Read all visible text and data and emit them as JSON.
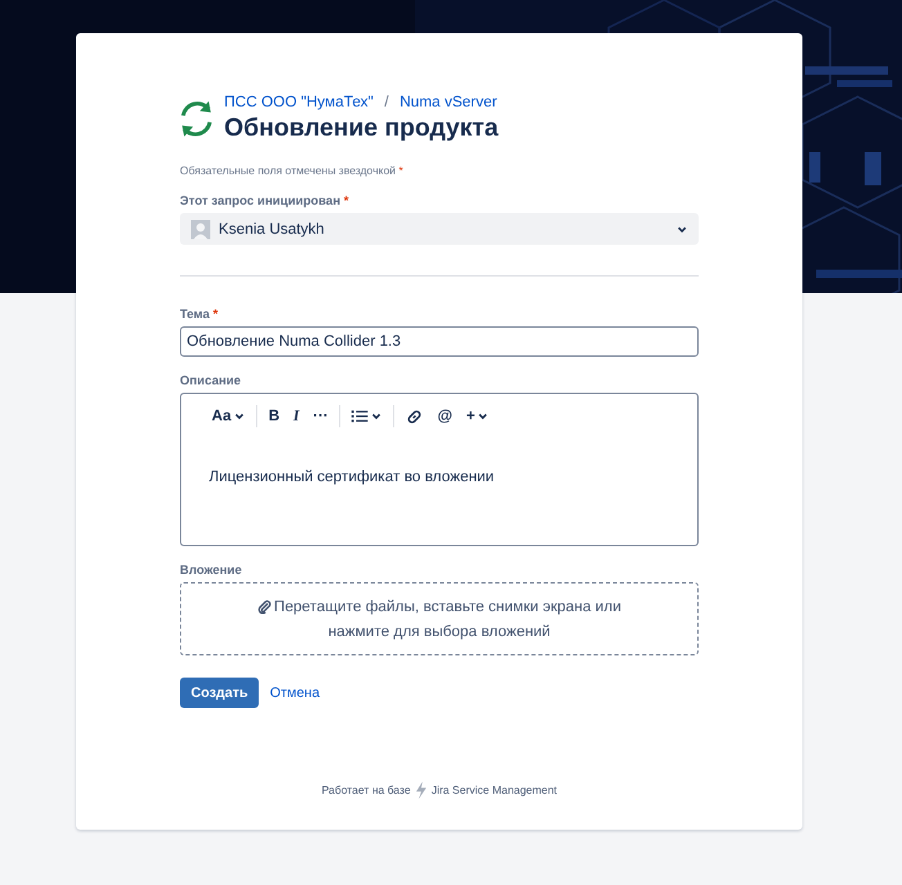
{
  "breadcrumbs": [
    {
      "label": "ПСС ООО \"НумаТех\""
    },
    {
      "label": "Numa vServer"
    }
  ],
  "breadcrumb_separator": "/",
  "title": "Обновление продукта",
  "required_note": "Обязательные поля отмечены звездочкой",
  "required_mark": "*",
  "fields": [
    {
      "kind": "select",
      "label": "Этот запрос инициирован",
      "required": true,
      "value": "Ksenia Usatykh"
    },
    {
      "kind": "divider"
    },
    {
      "kind": "text",
      "label": "Тема",
      "required": true,
      "value": "Обновление Numa Collider 1.3"
    },
    {
      "kind": "richtext",
      "label": "Описание",
      "required": false,
      "toolbar": [
        {
          "kind": "text",
          "label": "Aa",
          "caret": true
        },
        {
          "kind": "sep"
        },
        {
          "kind": "bold",
          "label": "B"
        },
        {
          "kind": "italic",
          "label": "I"
        },
        {
          "kind": "text",
          "label": "···"
        },
        {
          "kind": "sep"
        },
        {
          "kind": "list",
          "caret": true
        },
        {
          "kind": "sep"
        },
        {
          "kind": "link"
        },
        {
          "kind": "text",
          "label": "@"
        },
        {
          "kind": "text",
          "label": "+",
          "caret": true
        }
      ],
      "value": "Лицензионный сертификат во вложении"
    },
    {
      "kind": "attachment",
      "label": "Вложение",
      "required": false,
      "lines": [
        "Перетащите файлы, вставьте снимки экрана или",
        "нажмите для выбора вложений"
      ]
    }
  ],
  "buttons": [
    {
      "kind": "primary",
      "label": "Создать"
    },
    {
      "kind": "link",
      "label": "Отмена"
    }
  ],
  "footer": {
    "prefix": "Работает на базе",
    "product": "Jira Service Management"
  }
}
